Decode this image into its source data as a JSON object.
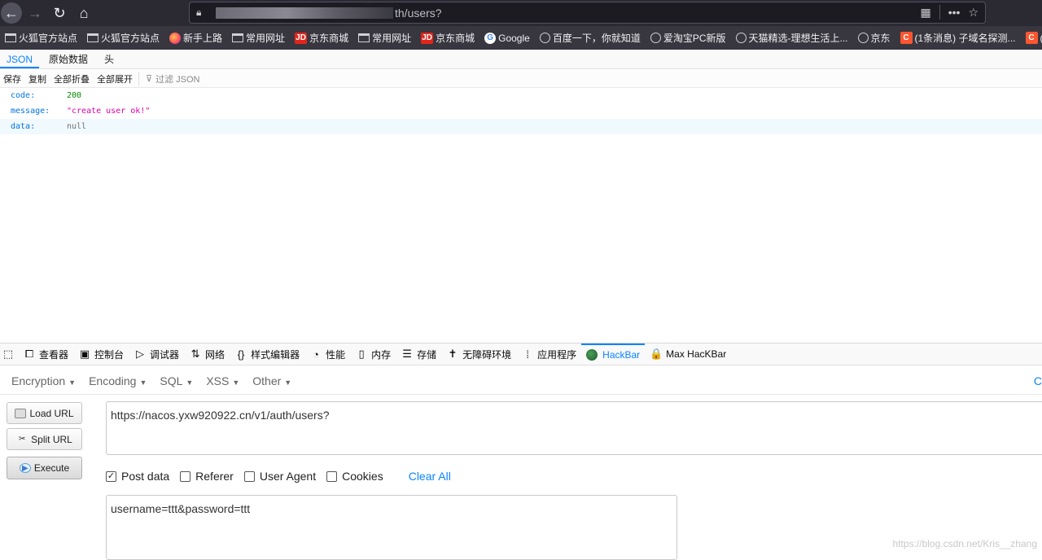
{
  "browser": {
    "url_visible_suffix": "th/users?",
    "icons": [
      "back-icon",
      "forward-icon",
      "reload-icon",
      "home-icon",
      "lock-icon",
      "qr-icon",
      "more-icon",
      "star-icon"
    ]
  },
  "bookmarks": [
    {
      "label": "火狐官方站点",
      "icon": "folder"
    },
    {
      "label": "火狐官方站点",
      "icon": "folder"
    },
    {
      "label": "新手上路",
      "icon": "fox"
    },
    {
      "label": "常用网址",
      "icon": "folder"
    },
    {
      "label": "京东商城",
      "icon": "jd"
    },
    {
      "label": "常用网址",
      "icon": "folder"
    },
    {
      "label": "京东商城",
      "icon": "jd"
    },
    {
      "label": "Google",
      "icon": "goog"
    },
    {
      "label": "百度一下，你就知道",
      "icon": "globe"
    },
    {
      "label": "爱淘宝PC新版",
      "icon": "globe"
    },
    {
      "label": "天猫精选-理想生活上...",
      "icon": "globe"
    },
    {
      "label": "京东",
      "icon": "globe"
    },
    {
      "label": "(1条消息) 子域名探测...",
      "icon": "csdn"
    },
    {
      "label": "(1",
      "icon": "csdn"
    }
  ],
  "json_viewer": {
    "tabs": [
      "JSON",
      "原始数据",
      "头"
    ],
    "toolbar": {
      "save": "保存",
      "copy": "复制",
      "collapse_all": "全部折叠",
      "expand_all": "全部展开",
      "filter_placeholder": "过滤 JSON"
    },
    "rows": [
      {
        "key": "code:",
        "value": "200",
        "type": "num"
      },
      {
        "key": "message:",
        "value": "\"create user ok!\"",
        "type": "str"
      },
      {
        "key": "data:",
        "value": "null",
        "type": "nul"
      }
    ]
  },
  "devtools": {
    "tabs": [
      {
        "label": "查看器",
        "icon": "inspector-icon",
        "glyph": "⧠"
      },
      {
        "label": "控制台",
        "icon": "console-icon",
        "glyph": "▣"
      },
      {
        "label": "调试器",
        "icon": "debugger-icon",
        "glyph": "▷"
      },
      {
        "label": "网络",
        "icon": "network-icon",
        "glyph": "⇅"
      },
      {
        "label": "样式编辑器",
        "icon": "style-editor-icon",
        "glyph": "{}"
      },
      {
        "label": "性能",
        "icon": "performance-icon",
        "glyph": "◔"
      },
      {
        "label": "内存",
        "icon": "memory-icon",
        "glyph": "▯"
      },
      {
        "label": "存储",
        "icon": "storage-icon",
        "glyph": "☰"
      },
      {
        "label": "无障碍环境",
        "icon": "accessibility-icon",
        "glyph": "✝"
      },
      {
        "label": "应用程序",
        "icon": "application-icon",
        "glyph": "⁞"
      },
      {
        "label": "HackBar",
        "icon": "hackbar-icon",
        "glyph": ""
      },
      {
        "label": "Max HacKBar",
        "icon": "lock-icon",
        "glyph": "🔒"
      }
    ]
  },
  "hackbar": {
    "menu": [
      "Encryption",
      "Encoding",
      "SQL",
      "XSS",
      "Other"
    ],
    "edge_char": "C",
    "buttons": {
      "load": "Load URL",
      "split": "Split URL",
      "execute": "Execute"
    },
    "url_value": "https://nacos.yxw920922.cn/v1/auth/users?",
    "options": [
      {
        "label": "Post data",
        "checked": true
      },
      {
        "label": "Referer",
        "checked": false
      },
      {
        "label": "User Agent",
        "checked": false
      },
      {
        "label": "Cookies",
        "checked": false
      }
    ],
    "clear_all": "Clear All",
    "post_value": "username=ttt&password=ttt"
  },
  "watermark": "https://blog.csdn.net/Kris__zhang"
}
